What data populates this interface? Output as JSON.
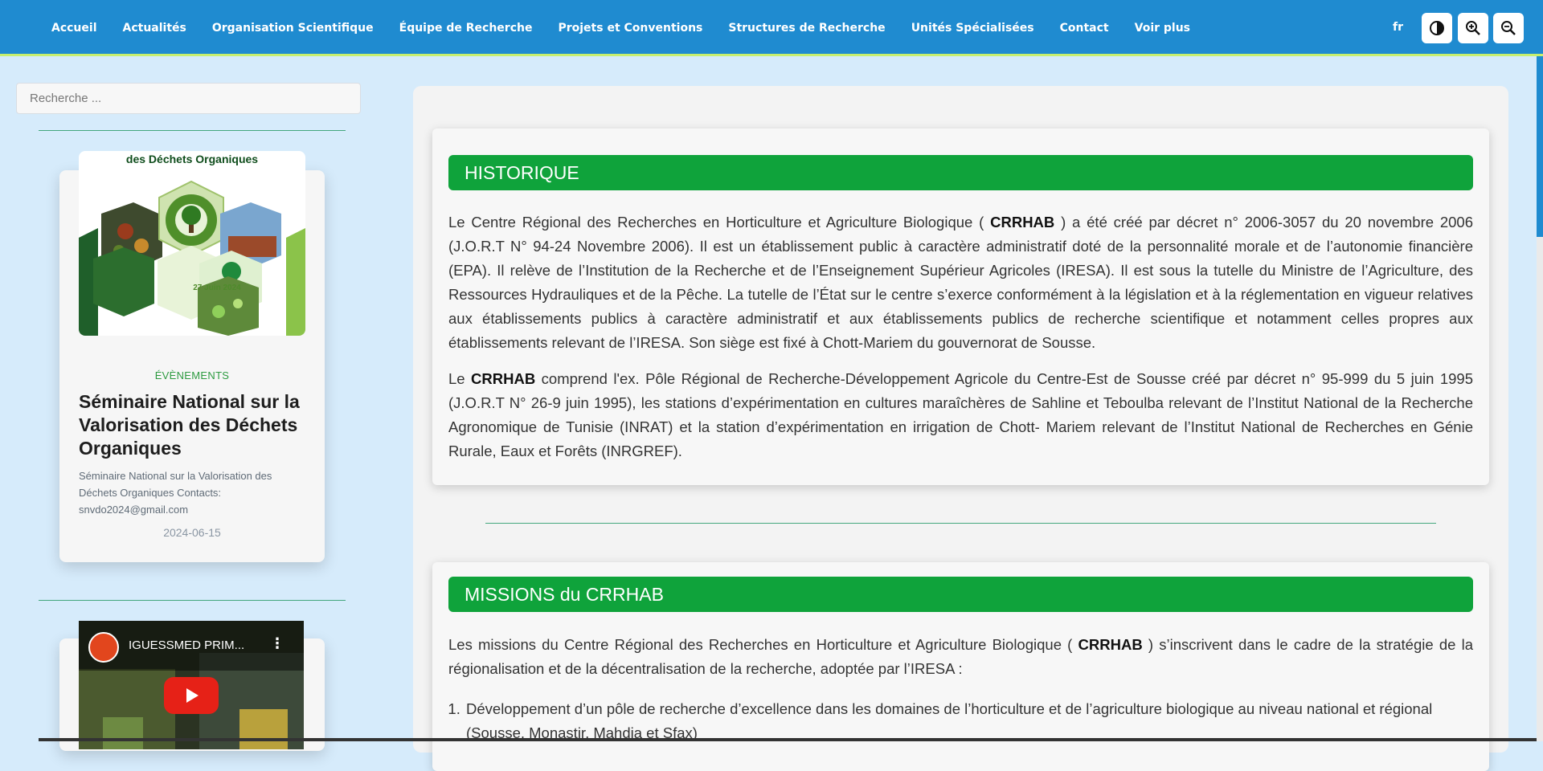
{
  "nav": {
    "items": [
      "Accueil",
      "Actualités",
      "Organisation Scientifique",
      "Équipe de Recherche",
      "Projets et Conventions",
      "Structures de Recherche",
      "Unités Spécialisées",
      "Contact",
      "Voir plus"
    ],
    "lang": "fr",
    "tools": [
      "dark-mode-toggle",
      "zoom-in",
      "zoom-out"
    ]
  },
  "sidebar": {
    "search_placeholder": "Recherche ...",
    "event": {
      "poster_title": "des Déchets Organiques",
      "poster_date": "27 Juin 2024",
      "category": "ÉVÈNEMENTS",
      "title": "Séminaire National sur la Valorisation des Déchets Organiques",
      "description": "Séminaire National sur la Valorisation des Déchets Organiques Contacts: snvdo2024@gmail.com",
      "date": "2024-06-15"
    },
    "video": {
      "title": "IGUESSMED PRIM..."
    }
  },
  "main": {
    "historique": {
      "heading": "HISTORIQUE",
      "p1_a": "Le Centre Régional des Recherches en Horticulture et Agriculture Biologique ( ",
      "p1_b": "CRRHAB",
      "p1_c": " ) a été créé par décret n° 2006-3057 du 20 novembre 2006 (J.O.R.T N° 94-24 Novembre 2006). Il est un établissement public à caractère administratif doté de la personnalité morale et de l’autonomie financière (EPA). Il relève de l’Institution de la Recherche et de l’Enseignement Supérieur Agricoles (IRESA). Il est sous la tutelle du Ministre de l’Agriculture, des Ressources Hydrauliques et de la Pêche. La tutelle de l’État sur le centre s’exerce conformément à la législation et à la réglementation en vigueur relatives aux établissements publics à caractère administratif et aux établissements publics de recherche scientifique et notamment celles propres aux établissements relevant de l’IRESA. Son siège est fixé à Chott-Mariem du gouvernorat de Sousse.",
      "p2_a": "Le ",
      "p2_b": "CRRHAB",
      "p2_c": " comprend l'ex. Pôle Régional de Recherche-Développement Agricole du Centre-Est de Sousse créé par décret n° 95-999 du 5 juin 1995 (J.O.R.T N° 26-9 juin 1995), les stations d’expérimentation en cultures maraîchères de Sahline et Teboulba relevant de l’Institut National de la Recherche Agronomique de Tunisie (INRAT) et la station d’expérimentation en irrigation de Chott- Mariem relevant de l’Institut National de Recherches en Génie Rurale, Eaux et Forêts (INRGREF)."
    },
    "missions": {
      "heading": "MISSIONS du CRRHAB",
      "intro_a": "Les missions du Centre Régional des Recherches en Horticulture et Agriculture Biologique ( ",
      "intro_b": "CRRHAB",
      "intro_c": " ) s’inscrivent dans le cadre de la stratégie de la régionalisation et de la décentralisation de la recherche, adoptée par l’IRESA :",
      "items": [
        "Développement d’un pôle de recherche d’excellence dans les domaines de l’horticulture et de l’agriculture biologique au niveau national et régional (Sousse, Monastir, Mahdia et Sfax)"
      ]
    }
  },
  "colors": {
    "navbar": "#1f8bd0",
    "accent_green": "#0fa33b",
    "page_bg": "#d6ebfb"
  }
}
